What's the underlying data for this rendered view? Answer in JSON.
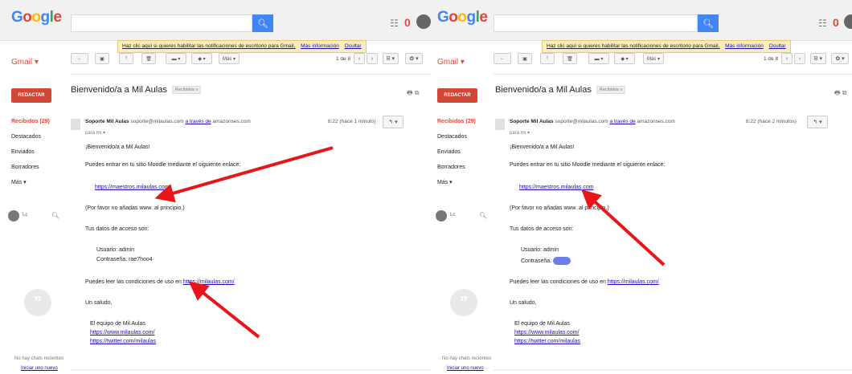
{
  "logo": "Google",
  "gmail_label": "Gmail ▾",
  "notify": {
    "text": "Haz clic aquí si quieres habilitar las notificaciones de escritorio para Gmail.",
    "more": "Más información",
    "hide": "Ocultar"
  },
  "apps_icon": "grid-icon",
  "notif_count": "0",
  "compose": "REDACTAR",
  "nav_left": [
    "Recibidos (29)",
    "Destacados",
    "Enviados",
    "Borradores",
    "Más ▾"
  ],
  "nav_right": [
    "Recibidos (29)",
    "Destacados",
    "Enviados",
    "Borradores",
    "Más ▾"
  ],
  "chat_user": "Lc",
  "no_chats": "No hay chats recientes",
  "start_chat": "Iniciar uno nuevo",
  "toolbar": {
    "back": "←",
    "archive": "▣",
    "spam": "!",
    "delete": "🗑",
    "folder": "▬ ▾",
    "label": "◆ ▾",
    "more": "Más ▾"
  },
  "pager": {
    "range": "1 de 8",
    "prev": "‹",
    "next": "›",
    "lang": "B ▾",
    "settings": "✿ ▾"
  },
  "email": {
    "subject": "Bienvenido/a a Mil Aulas",
    "tag": "Recibidos x",
    "print_icons": "🖶 ⧉",
    "sender_name": "Soporte Mil Aulas",
    "sender_email": "soporte@milaulas.com",
    "via": "a través de",
    "via_domain": "amazonses.com",
    "to_me": "para mí ▾",
    "time_left": "8:22 (hace 1 minuto)",
    "time_right": "8:22 (hace 2 minutos)",
    "reply": "↰ ▾",
    "greeting": "¡Bienvenido/a a Mil Aulas!",
    "intro": "Puedes entrar en tu sitio Moodle mediante el siguiente enlace:",
    "site_link": "https://maestros.milaulas.com",
    "note": "(Por favor no añadas www. al principio.)",
    "access_label": "Tus datos de acceso son:",
    "user_line": "Usuario: admin",
    "pass_line_left": "Contraseña: rae7hoo4",
    "pass_line_right": "Contraseña:",
    "terms": "Puedes leer las condiciones de uso en",
    "terms_link": "https://milaulas.com/",
    "regards": "Un saludo,",
    "team": "El equipo de Mil Aulas",
    "team_link1": "https://www.milaulas.com/",
    "team_link2": "https://twitter.com/milaulas"
  },
  "colors": {
    "arrow": "#e8161b",
    "compose": "#d14836",
    "accent": "#4285f4"
  }
}
